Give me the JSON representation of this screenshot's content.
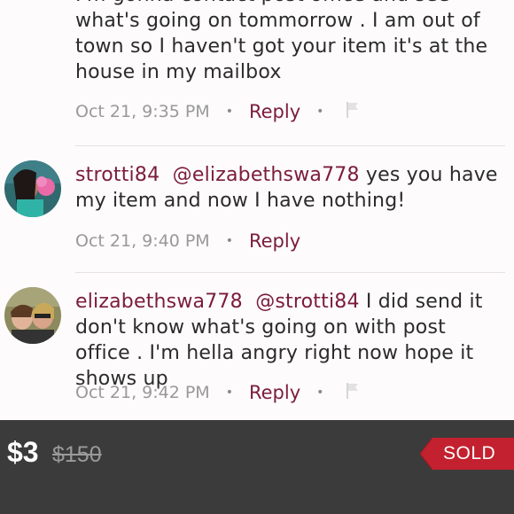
{
  "comments": [
    {
      "text": "I'm gonna contact post office and see what's going on tommorrow . I am out of town so I haven't got your item it's at the house in my mailbox",
      "timestamp": "Oct 21, 9:35 PM",
      "reply_label": "Reply",
      "has_flag": true
    },
    {
      "username": "strotti84",
      "mention": "@elizabethswa778",
      "text": " yes you have my item and now I have nothing!",
      "timestamp": "Oct 21, 9:40 PM",
      "reply_label": "Reply",
      "has_flag": false
    },
    {
      "username": "elizabethswa778",
      "mention": "@strotti84",
      "text": " I did send it don't know what's going on with post office . I'm hella angry right now hope it shows up",
      "timestamp": "Oct 21, 9:42 PM",
      "reply_label": "Reply",
      "has_flag": true
    }
  ],
  "separator": "•",
  "footer": {
    "price": "$3",
    "original_price": "$150",
    "status_badge": "SOLD"
  },
  "colors": {
    "accent": "#7b1c3a",
    "sold_tag": "#c3212f",
    "footer_bg": "#3b3b3b"
  },
  "icons": {
    "flag": "flag-icon"
  }
}
